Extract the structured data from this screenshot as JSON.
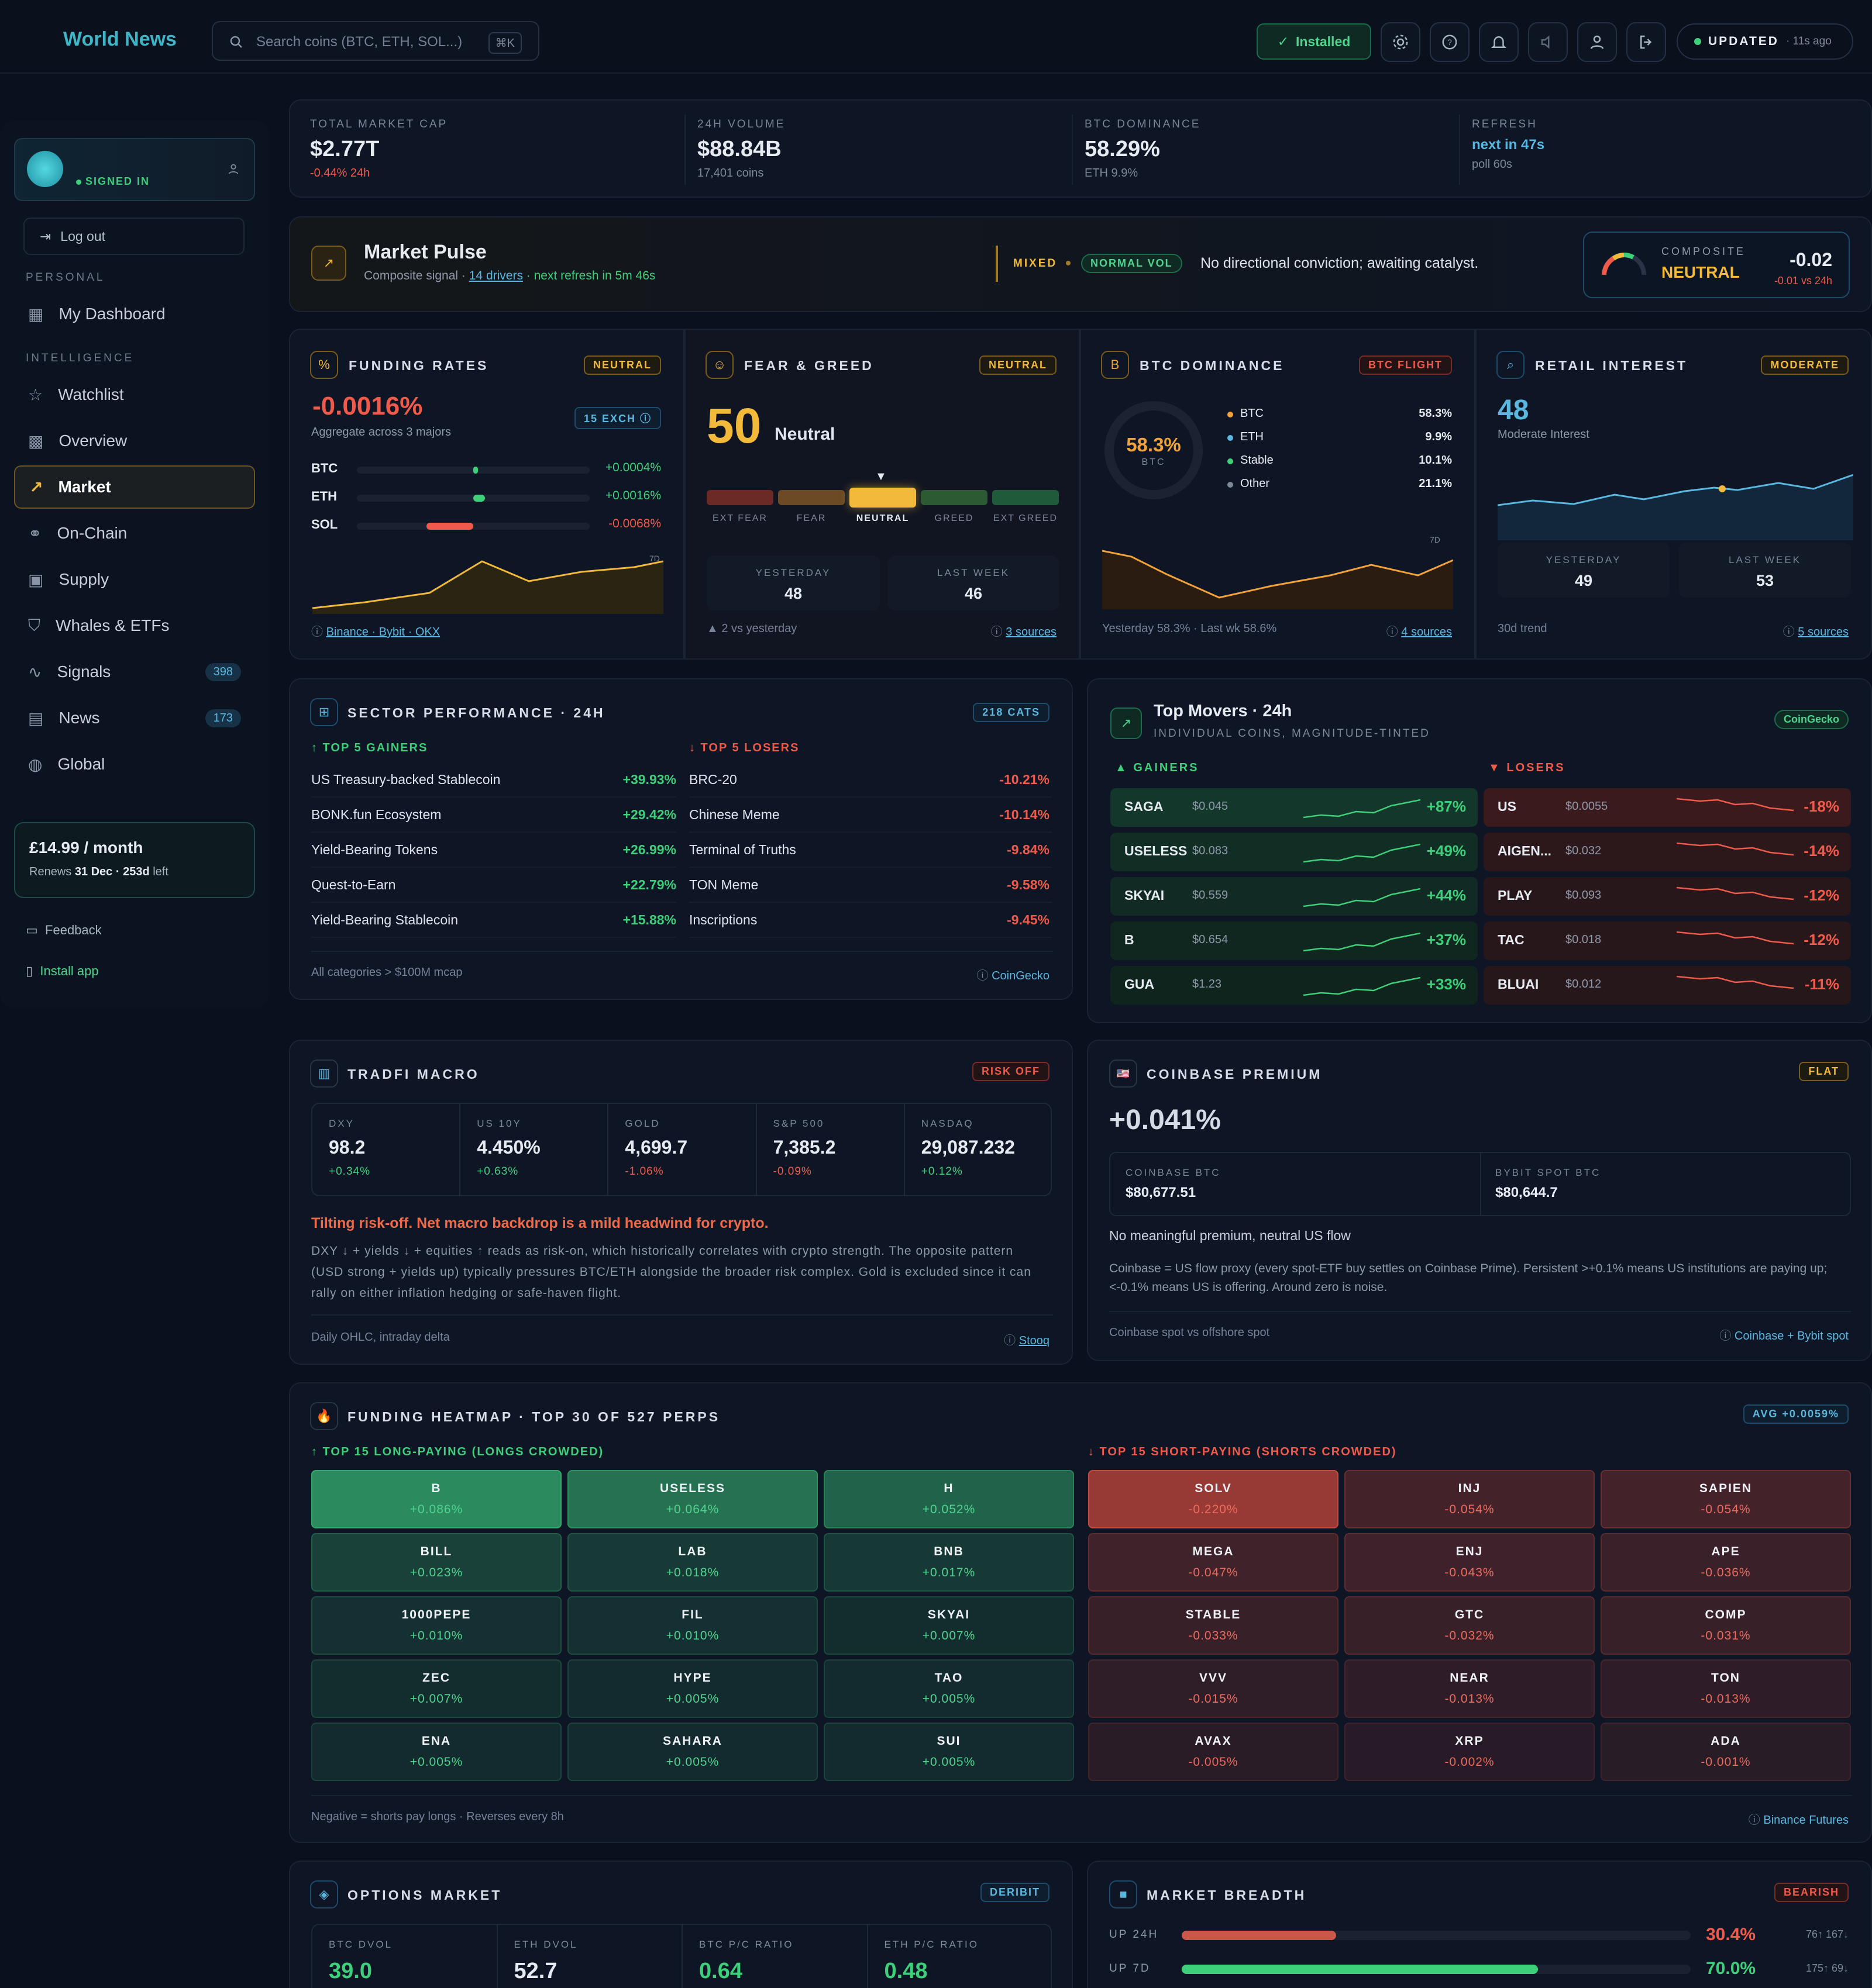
{
  "app": {
    "title": "World News"
  },
  "search": {
    "placeholder": "Search coins (BTC, ETH, SOL...)",
    "shortcut": "⌘K"
  },
  "topbar": {
    "installed": "Installed",
    "updated": "UPDATED",
    "updated_ago": "· 11s ago"
  },
  "sidebar": {
    "signed_in": "SIGNED IN",
    "logout": "Log out",
    "personal": "PERSONAL",
    "intelligence": "INTELLIGENCE",
    "items": [
      {
        "label": "My Dashboard",
        "icon": "dashboard-icon"
      },
      {
        "label": "Watchlist",
        "icon": "star-icon"
      },
      {
        "label": "Overview",
        "icon": "grid-icon"
      },
      {
        "label": "Market",
        "icon": "trend-icon"
      },
      {
        "label": "On-Chain",
        "icon": "link-icon"
      },
      {
        "label": "Supply",
        "icon": "box-icon"
      },
      {
        "label": "Whales & ETFs",
        "icon": "shield-icon"
      },
      {
        "label": "Signals",
        "icon": "pulse-icon",
        "count": "398"
      },
      {
        "label": "News",
        "icon": "news-icon",
        "count": "173"
      },
      {
        "label": "Global",
        "icon": "globe-icon"
      }
    ],
    "plan": {
      "price": "£14.99 / month",
      "renews_prefix": "Renews ",
      "renews_date": "31 Dec · 253d",
      "renews_suffix": " left"
    },
    "feedback": "Feedback",
    "install": "Install app"
  },
  "kpis": [
    {
      "label": "TOTAL MARKET CAP",
      "value": "$2.77T",
      "sub": "-0.44% 24h"
    },
    {
      "label": "24H VOLUME",
      "value": "$88.84B",
      "sub": "17,401 coins"
    },
    {
      "label": "BTC DOMINANCE",
      "value": "58.29%",
      "sub": "ETH 9.9%"
    },
    {
      "label": "REFRESH",
      "value": "next in 47s",
      "sub": "poll 60s"
    }
  ],
  "pulse": {
    "title": "Market Pulse",
    "subtitle_a": "Composite signal · ",
    "drivers": "14 drivers",
    "subtitle_b": " · next refresh in 5m 46s",
    "mixed": "MIXED",
    "vol": "NORMAL VOL",
    "message": "No directional conviction; awaiting catalyst.",
    "composite_label": "COMPOSITE",
    "composite_state": "NEUTRAL",
    "composite_value": "-0.02",
    "composite_delta": "-0.01 vs 24h"
  },
  "funding": {
    "title": "FUNDING RATES",
    "badge": "NEUTRAL",
    "value": "-0.0016%",
    "sub": "Aggregate across 3 majors",
    "exch": "15 EXCH",
    "rows": [
      {
        "sym": "BTC",
        "val": "+0.0004%",
        "frac": 0.02
      },
      {
        "sym": "ETH",
        "val": "+0.0016%",
        "frac": 0.05
      },
      {
        "sym": "SOL",
        "val": "-0.0068%",
        "frac": -0.2
      }
    ],
    "chart_tag": "7D",
    "sources": "Binance · Bybit · OKX"
  },
  "feargreed": {
    "title": "FEAR & GREED",
    "badge": "NEUTRAL",
    "value": "50",
    "label": "Neutral",
    "scale": [
      "EXT FEAR",
      "FEAR",
      "NEUTRAL",
      "GREED",
      "EXT GREED"
    ],
    "yesterday_label": "YESTERDAY",
    "yesterday": "48",
    "lastweek_label": "LAST WEEK",
    "lastweek": "46",
    "delta": "▲ 2 vs yesterday",
    "sources": "3 sources"
  },
  "dominance": {
    "title": "BTC DOMINANCE",
    "badge": "BTC FLIGHT",
    "value": "58.3%",
    "sub": "BTC",
    "legend": [
      {
        "name": "BTC",
        "val": "58.3%",
        "color": "#f2a23a"
      },
      {
        "name": "ETH",
        "val": "9.9%",
        "color": "#5ab8e0"
      },
      {
        "name": "Stable",
        "val": "10.1%",
        "color": "#3ecf7a"
      },
      {
        "name": "Other",
        "val": "21.1%",
        "color": "#7d8899"
      }
    ],
    "chart_tag": "7D",
    "footer": "Yesterday 58.3% · Last wk 58.6%",
    "sources": "4 sources"
  },
  "retail": {
    "title": "RETAIL INTEREST",
    "badge": "MODERATE",
    "value": "48",
    "sub": "Moderate Interest",
    "yesterday_label": "YESTERDAY",
    "yesterday": "49",
    "lastweek_label": "LAST WEEK",
    "lastweek": "53",
    "footer": "30d trend",
    "sources": "5 sources"
  },
  "sectors": {
    "title": "SECTOR PERFORMANCE · 24H",
    "badge": "218 CATS",
    "gainers_label": "↑ TOP 5 GAINERS",
    "losers_label": "↓ TOP 5 LOSERS",
    "gainers": [
      {
        "name": "US Treasury-backed Stablecoin",
        "val": "+39.93%"
      },
      {
        "name": "BONK.fun Ecosystem",
        "val": "+29.42%"
      },
      {
        "name": "Yield-Bearing Tokens",
        "val": "+26.99%"
      },
      {
        "name": "Quest-to-Earn",
        "val": "+22.79%"
      },
      {
        "name": "Yield-Bearing Stablecoin",
        "val": "+15.88%"
      }
    ],
    "losers": [
      {
        "name": "BRC-20",
        "val": "-10.21%"
      },
      {
        "name": "Chinese Meme",
        "val": "-10.14%"
      },
      {
        "name": "Terminal of Truths",
        "val": "-9.84%"
      },
      {
        "name": "TON Meme",
        "val": "-9.58%"
      },
      {
        "name": "Inscriptions",
        "val": "-9.45%"
      }
    ],
    "footer": "All categories > $100M mcap",
    "source": "CoinGecko"
  },
  "movers": {
    "title": "Top Movers · 24h",
    "subtitle": "INDIVIDUAL COINS, MAGNITUDE-TINTED",
    "badge": "CoinGecko",
    "gainers_label": "▲ GAINERS",
    "losers_label": "▼ LOSERS",
    "gainers": [
      {
        "sym": "SAGA",
        "price": "$0.045",
        "chg": "+87%"
      },
      {
        "sym": "USELESS",
        "price": "$0.083",
        "chg": "+49%"
      },
      {
        "sym": "SKYAI",
        "price": "$0.559",
        "chg": "+44%"
      },
      {
        "sym": "B",
        "price": "$0.654",
        "chg": "+37%"
      },
      {
        "sym": "GUA",
        "price": "$1.23",
        "chg": "+33%"
      }
    ],
    "losers": [
      {
        "sym": "US",
        "price": "$0.0055",
        "chg": "-18%"
      },
      {
        "sym": "AIGEN...",
        "price": "$0.032",
        "chg": "-14%"
      },
      {
        "sym": "PLAY",
        "price": "$0.093",
        "chg": "-12%"
      },
      {
        "sym": "TAC",
        "price": "$0.018",
        "chg": "-12%"
      },
      {
        "sym": "BLUAI",
        "price": "$0.012",
        "chg": "-11%"
      }
    ]
  },
  "macro": {
    "title": "TRADFI MACRO",
    "badge": "RISK OFF",
    "cols": [
      {
        "label": "DXY",
        "value": "98.2",
        "chg": "+0.34%"
      },
      {
        "label": "US 10Y",
        "value": "4.450%",
        "chg": "+0.63%"
      },
      {
        "label": "GOLD",
        "value": "4,699.7",
        "chg": "-1.06%"
      },
      {
        "label": "S&P 500",
        "value": "7,385.2",
        "chg": "-0.09%"
      },
      {
        "label": "NASDAQ",
        "value": "29,087.232",
        "chg": "+0.12%"
      }
    ],
    "headline": "Tilting risk-off. Net macro backdrop is a mild headwind for crypto.",
    "body": "DXY ↓ + yields ↓ + equities ↑ reads as risk-on, which historically correlates with crypto strength. The opposite pattern (USD strong + yields up) typically pressures BTC/ETH alongside the broader risk complex. Gold is excluded since it can rally on either inflation hedging or safe-haven flight.",
    "footer": "Daily OHLC, intraday delta",
    "source": "Stooq"
  },
  "premium": {
    "title": "COINBASE PREMIUM",
    "badge": "FLAT",
    "value": "+0.041%",
    "cb_label": "COINBASE BTC",
    "cb_value": "$80,677.51",
    "by_label": "BYBIT SPOT BTC",
    "by_value": "$80,644.7",
    "note": "No meaningful premium, neutral US flow",
    "body": "Coinbase = US flow proxy (every spot-ETF buy settles on Coinbase Prime). Persistent >+0.1% means US institutions are paying up; <-0.1% means US is offering. Around zero is noise.",
    "footer": "Coinbase spot vs offshore spot",
    "source": "Coinbase + Bybit spot"
  },
  "heatmap": {
    "title": "FUNDING HEATMAP · TOP 30 OF 527 PERPS",
    "badge": "AVG +0.0059%",
    "long_label": "↑ TOP 15 LONG-PAYING (LONGS CROWDED)",
    "short_label": "↓ TOP 15 SHORT-PAYING (SHORTS CROWDED)",
    "long": [
      {
        "s": "B",
        "v": "+0.086%",
        "i": 1
      },
      {
        "s": "USELESS",
        "v": "+0.064%",
        "i": 0.74
      },
      {
        "s": "H",
        "v": "+0.052%",
        "i": 0.6
      },
      {
        "s": "BILL",
        "v": "+0.023%",
        "i": 0.27
      },
      {
        "s": "LAB",
        "v": "+0.018%",
        "i": 0.21
      },
      {
        "s": "BNB",
        "v": "+0.017%",
        "i": 0.2
      },
      {
        "s": "1000PEPE",
        "v": "+0.010%",
        "i": 0.12
      },
      {
        "s": "FIL",
        "v": "+0.010%",
        "i": 0.12
      },
      {
        "s": "SKYAI",
        "v": "+0.007%",
        "i": 0.08
      },
      {
        "s": "ZEC",
        "v": "+0.007%",
        "i": 0.08
      },
      {
        "s": "HYPE",
        "v": "+0.005%",
        "i": 0.06
      },
      {
        "s": "TAO",
        "v": "+0.005%",
        "i": 0.06
      },
      {
        "s": "ENA",
        "v": "+0.005%",
        "i": 0.06
      },
      {
        "s": "SAHARA",
        "v": "+0.005%",
        "i": 0.06
      },
      {
        "s": "SUI",
        "v": "+0.005%",
        "i": 0.06
      }
    ],
    "short": [
      {
        "s": "SOLV",
        "v": "-0.220%",
        "i": 1
      },
      {
        "s": "INJ",
        "v": "-0.054%",
        "i": 0.25
      },
      {
        "s": "SAPIEN",
        "v": "-0.054%",
        "i": 0.25
      },
      {
        "s": "MEGA",
        "v": "-0.047%",
        "i": 0.21
      },
      {
        "s": "ENJ",
        "v": "-0.043%",
        "i": 0.2
      },
      {
        "s": "APE",
        "v": "-0.036%",
        "i": 0.16
      },
      {
        "s": "STABLE",
        "v": "-0.033%",
        "i": 0.15
      },
      {
        "s": "GTC",
        "v": "-0.032%",
        "i": 0.15
      },
      {
        "s": "COMP",
        "v": "-0.031%",
        "i": 0.14
      },
      {
        "s": "VVV",
        "v": "-0.015%",
        "i": 0.07
      },
      {
        "s": "NEAR",
        "v": "-0.013%",
        "i": 0.06
      },
      {
        "s": "TON",
        "v": "-0.013%",
        "i": 0.06
      },
      {
        "s": "AVAX",
        "v": "-0.005%",
        "i": 0.02
      },
      {
        "s": "XRP",
        "v": "-0.002%",
        "i": 0.01
      },
      {
        "s": "ADA",
        "v": "-0.001%",
        "i": 0.005
      }
    ],
    "footer": "Negative = shorts pay longs · Reverses every 8h",
    "source": "Binance Futures"
  },
  "options": {
    "title": "OPTIONS MARKET",
    "badge": "DERIBIT",
    "cols": [
      {
        "label": "BTC DVOL",
        "value": "39.0"
      },
      {
        "label": "ETH DVOL",
        "value": "52.7"
      },
      {
        "label": "BTC P/C RATIO",
        "value": "0.64"
      },
      {
        "label": "ETH P/C RATIO",
        "value": "0.48"
      }
    ]
  },
  "breadth": {
    "title": "MARKET BREADTH",
    "badge": "BEARISH",
    "rows": [
      {
        "label": "UP 24H",
        "pct": "30.4%",
        "frac": 0.304,
        "counts": "76↑ 167↓"
      },
      {
        "label": "UP 7D",
        "pct": "70.0%",
        "frac": 0.7,
        "counts": "175↑ 69↓"
      }
    ]
  }
}
